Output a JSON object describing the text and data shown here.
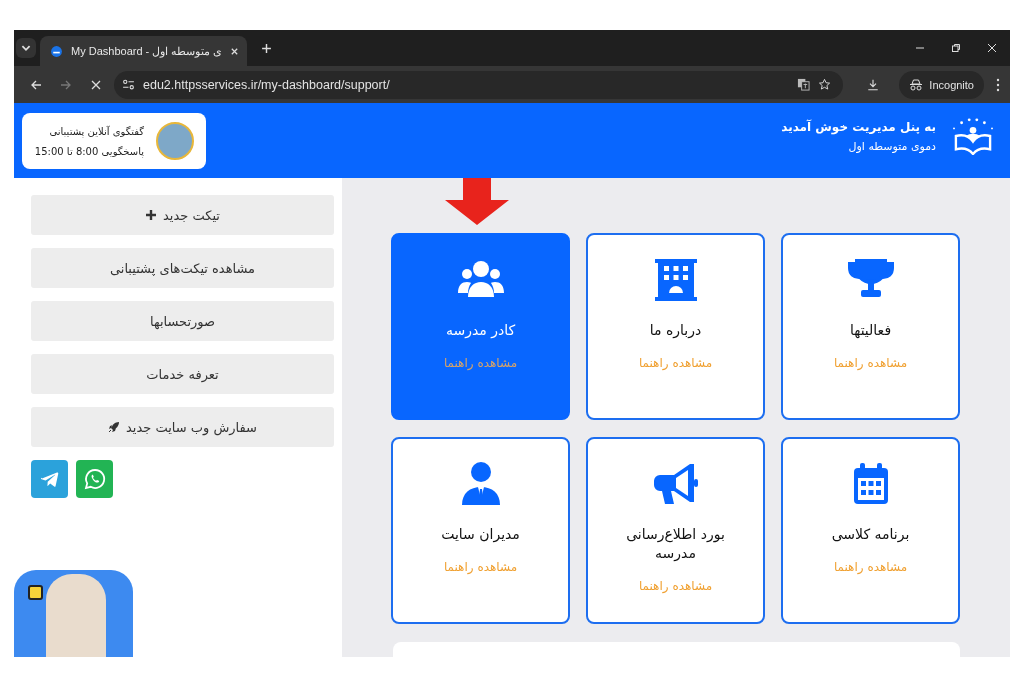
{
  "browser": {
    "tabs": [
      {
        "title": "My Dashboard - ی متوسطه اول",
        "selected": true
      }
    ],
    "url": "edu2.httpsservices.ir/my-dashboard/support/",
    "profile_label": "Incognito"
  },
  "header": {
    "title": "به پنل مدیریت خوش آمدید",
    "subtitle": "دموی متوسطه اول",
    "support": {
      "title": "گفتگوی آنلاین پشتیبانی",
      "hours": "پاسخگویی 8:00 تا 15:00"
    }
  },
  "cards": [
    {
      "title": "فعالیتها",
      "link": "مشاهده راهنما",
      "kind": "trophy",
      "selected": false
    },
    {
      "title": "درباره ما",
      "link": "مشاهده راهنما",
      "kind": "building",
      "selected": false
    },
    {
      "title": "کادر مدرسه",
      "link": "مشاهده راهنما",
      "kind": "users",
      "selected": true
    },
    {
      "title": "برنامه کلاسی",
      "link": "مشاهده راهنما",
      "kind": "calendar",
      "selected": false
    },
    {
      "title": "بورد اطلاع‌رسانی مدرسه",
      "link": "مشاهده راهنما",
      "kind": "megaphone",
      "selected": false
    },
    {
      "title": "مدیران سایت",
      "link": "مشاهده راهنما",
      "kind": "manager",
      "selected": false
    }
  ],
  "sidebar": {
    "buttons": [
      {
        "label": "تیکت جدید",
        "kind": "plus"
      },
      {
        "label": "مشاهده تیکت‌های پشتیبانی",
        "kind": "plain"
      },
      {
        "label": "صورتحسابها",
        "kind": "plain"
      },
      {
        "label": "تعرفه خدمات",
        "kind": "plain"
      },
      {
        "label": "سفارش وب سایت جدید",
        "kind": "rocket"
      }
    ],
    "socials": [
      {
        "kind": "telegram"
      },
      {
        "kind": "whatsapp"
      }
    ]
  }
}
